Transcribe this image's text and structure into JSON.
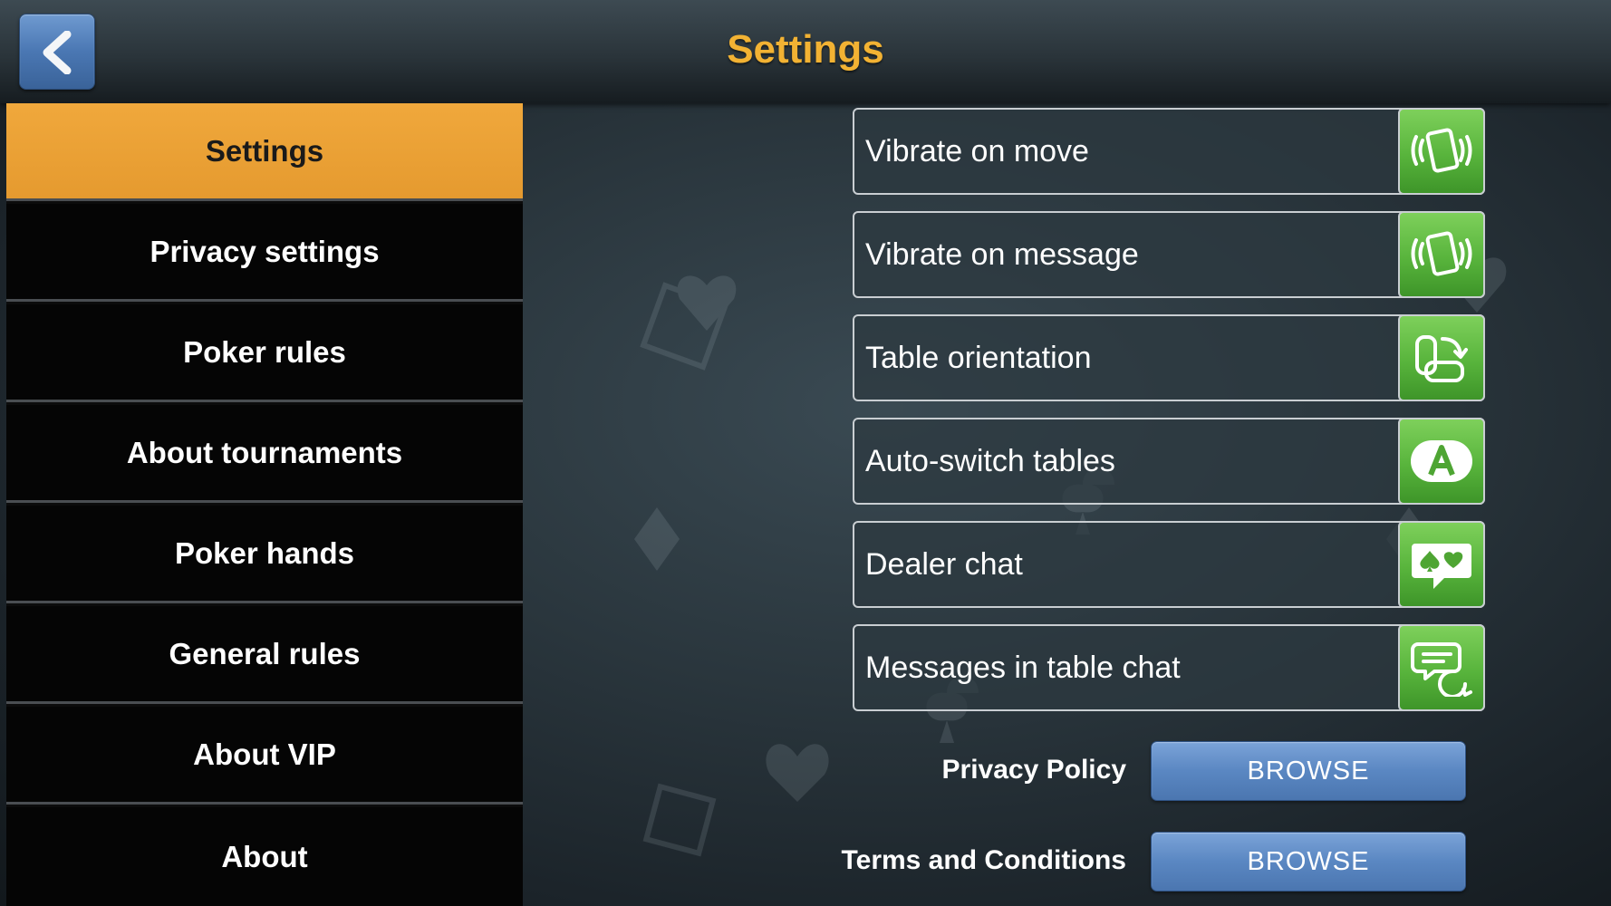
{
  "header": {
    "title": "Settings",
    "back_icon": "chevron-left-icon"
  },
  "sidebar": {
    "items": [
      {
        "label": "Settings",
        "active": true
      },
      {
        "label": "Privacy settings",
        "active": false
      },
      {
        "label": "Poker rules",
        "active": false
      },
      {
        "label": "About tournaments",
        "active": false
      },
      {
        "label": "Poker hands",
        "active": false
      },
      {
        "label": "General rules",
        "active": false
      },
      {
        "label": "About VIP",
        "active": false
      },
      {
        "label": "About",
        "active": false
      }
    ]
  },
  "settings": {
    "items": [
      {
        "label": "Vibrate on move",
        "icon": "vibrate-phone-icon"
      },
      {
        "label": "Vibrate on message",
        "icon": "vibrate-phone-icon"
      },
      {
        "label": "Table orientation",
        "icon": "rotate-device-icon"
      },
      {
        "label": "Auto-switch tables",
        "icon": "letter-a-icon"
      },
      {
        "label": "Dealer chat",
        "icon": "suits-chat-icon"
      },
      {
        "label": "Messages in table chat",
        "icon": "chat-bubble-icon"
      }
    ]
  },
  "links": {
    "privacy_policy": {
      "label": "Privacy Policy",
      "button": "BROWSE"
    },
    "terms": {
      "label": "Terms and Conditions",
      "button": "BROWSE"
    }
  },
  "colors": {
    "accent": "#f2b233",
    "active_tab": "#e9a035",
    "toggle_on": "#5cb83e",
    "browse_button": "#5a87c2"
  }
}
